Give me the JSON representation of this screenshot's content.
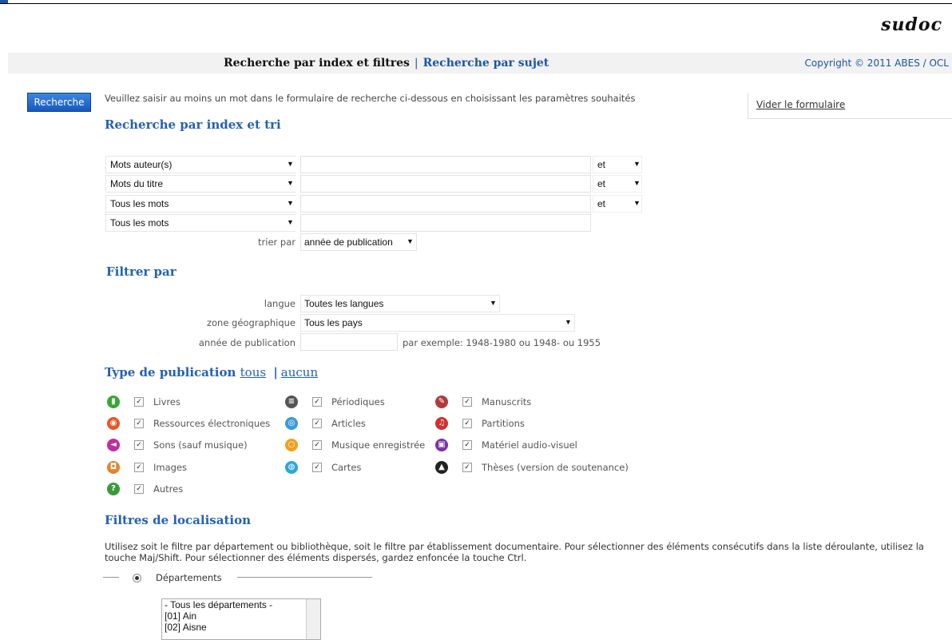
{
  "brand": {
    "logo": "sudoc"
  },
  "nav": {
    "tab_active": "Recherche par index et filtres",
    "separator": "|",
    "tab_other": "Recherche par sujet",
    "copyright": "Copyright © 2011 ABES / OCL"
  },
  "search_button": "Recherche",
  "intro": "Veuillez saisir au moins un mot dans le formulaire de recherche ci-dessous en choisissant les paramètres souhaités",
  "clear_form": "Vider le formulaire",
  "index_section": {
    "title": "Recherche par index et tri",
    "rows": [
      {
        "field": "Mots auteur(s)",
        "value": "",
        "op": "et"
      },
      {
        "field": "Mots du titre",
        "value": "",
        "op": "et"
      },
      {
        "field": "Tous les mots",
        "value": "",
        "op": "et"
      },
      {
        "field": "Tous les mots",
        "value": ""
      }
    ],
    "sort_label": "trier par",
    "sort_value": "année de publication"
  },
  "filter_section": {
    "title": "Filtrer par",
    "language_label": "langue",
    "language_value": "Toutes les langues",
    "zone_label": "zone géographique",
    "zone_value": "Tous les pays",
    "year_label": "année de publication",
    "year_value": "",
    "year_hint": "par exemple: 1948-1980 ou 1948- ou 1955"
  },
  "pub_section": {
    "title": "Type de publication",
    "all": "tous",
    "sep": "|",
    "none": "aucun",
    "types": [
      {
        "label": "Livres",
        "icon": "book-icon",
        "color": "#3aa635",
        "checked": true
      },
      {
        "label": "Périodiques",
        "icon": "periodical-icon",
        "color": "#555555",
        "checked": true
      },
      {
        "label": "Manuscrits",
        "icon": "manuscript-icon",
        "color": "#b33a3a",
        "checked": true
      },
      {
        "label": "Ressources électroniques",
        "icon": "electronic-icon",
        "color": "#e8562a",
        "checked": true
      },
      {
        "label": "Articles",
        "icon": "article-icon",
        "color": "#3a9ad6",
        "checked": true
      },
      {
        "label": "Partitions",
        "icon": "score-icon",
        "color": "#d0302f",
        "checked": true
      },
      {
        "label": "Sons (sauf musique)",
        "icon": "sound-icon",
        "color": "#c02ea0",
        "checked": true
      },
      {
        "label": "Musique enregistrée",
        "icon": "music-icon",
        "color": "#f0a020",
        "checked": true
      },
      {
        "label": "Matériel audio-visuel",
        "icon": "audiovisual-icon",
        "color": "#7a2fa8",
        "checked": true
      },
      {
        "label": "Images",
        "icon": "image-icon",
        "color": "#e8822a",
        "checked": true
      },
      {
        "label": "Cartes",
        "icon": "map-icon",
        "color": "#2aa8d8",
        "checked": true
      },
      {
        "label": "Thèses (version de soutenance)",
        "icon": "thesis-icon",
        "color": "#222222",
        "checked": true
      },
      {
        "label": "Autres",
        "icon": "question-icon",
        "color": "#3a9a3a",
        "checked": true
      }
    ]
  },
  "location_section": {
    "title": "Filtres de localisation",
    "paragraph": "Utilisez soit le filtre par département ou bibliothèque, soit le filtre par établissement documentaire. Pour sélectionner des éléments consécutifs dans la liste déroulante, utilisez la touche Maj/Shift. Pour sélectionner des éléments dispersés, gardez enfoncée la touche Ctrl.",
    "radio_label": "Départements",
    "list": [
      "- Tous les départements -",
      "[01] Ain",
      "[02] Aisne"
    ]
  }
}
